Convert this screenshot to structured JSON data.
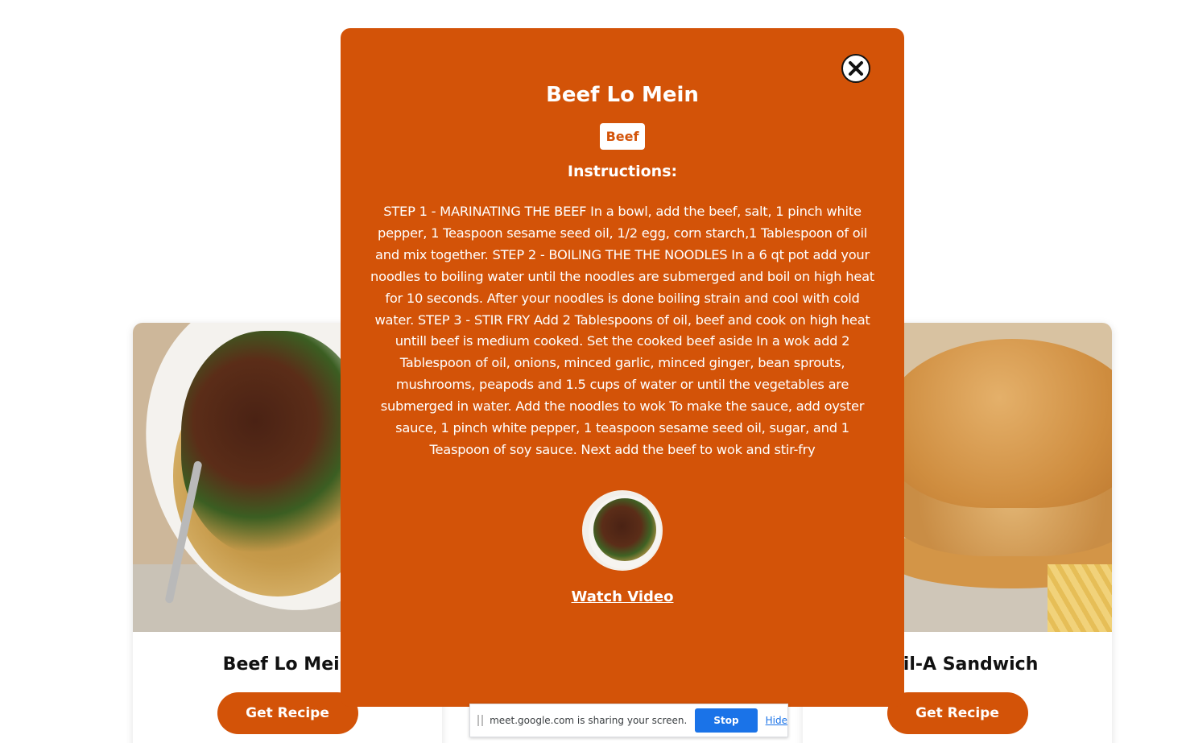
{
  "cards": [
    {
      "title": "Beef Lo Mein",
      "button": "Get Recipe"
    },
    {
      "title": "",
      "button": ""
    },
    {
      "title": "k-Fil-A Sandwich",
      "button": "Get Recipe"
    }
  ],
  "modal": {
    "title": "Beef Lo Mein",
    "category": "Beef",
    "instructions_heading": "Instructions:",
    "instructions": "STEP 1 - MARINATING THE BEEF In a bowl, add the beef, salt, 1 pinch white pepper, 1 Teaspoon sesame seed oil, 1/2 egg, corn starch,1 Tablespoon of oil and mix together. STEP 2 - BOILING THE THE NOODLES In a 6 qt pot add your noodles to boiling water until the noodles are submerged and boil on high heat for 10 seconds. After your noodles is done boiling strain and cool with cold water. STEP 3 - STIR FRY Add 2 Tablespoons of oil, beef and cook on high heat untill beef is medium cooked. Set the cooked beef aside In a wok add 2 Tablespoon of oil, onions, minced garlic, minced ginger, bean sprouts, mushrooms, peapods and 1.5 cups of water or until the vegetables are submerged in water. Add the noodles to wok To make the sauce, add oyster sauce, 1 pinch white pepper, 1 teaspoon sesame seed oil, sugar, and 1 Teaspoon of soy sauce. Next add the beef to wok and stir-fry",
    "watch_video": "Watch Video",
    "close_icon": "close-icon"
  },
  "share_bar": {
    "message": "meet.google.com is sharing your screen.",
    "stop_label": "Stop sharing",
    "hide_label": "Hide"
  },
  "colors": {
    "accent": "#d35308",
    "stop_button": "#1a73e8"
  }
}
